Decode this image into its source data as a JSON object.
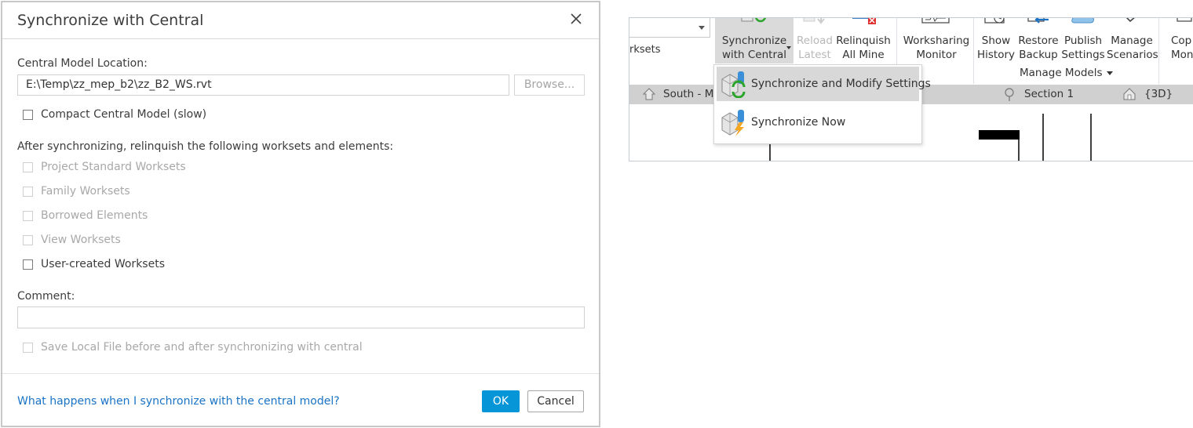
{
  "dialog": {
    "title": "Synchronize with Central",
    "central_model_label": "Central Model Location:",
    "central_model_value": "E:\\Temp\\zz_mep_b2\\zz_B2_WS.rvt",
    "browse_label": "Browse...",
    "compact_label": "Compact Central Model (slow)",
    "relinquish_heading": "After synchronizing, relinquish the following worksets and elements:",
    "relinquish_options": [
      {
        "label": "Project Standard Worksets",
        "enabled": false
      },
      {
        "label": "Family Worksets",
        "enabled": false
      },
      {
        "label": "Borrowed Elements",
        "enabled": false
      },
      {
        "label": "View Worksets",
        "enabled": false
      },
      {
        "label": "User-created Worksets",
        "enabled": true
      }
    ],
    "comment_label": "Comment:",
    "comment_value": "",
    "save_local_label": "Save Local File before and after synchronizing with central",
    "help_link": "What happens when I synchronize with the central model?",
    "ok_label": "OK",
    "cancel_label": "Cancel"
  },
  "ribbon": {
    "worksets_label": "rksets",
    "buttons": [
      {
        "l1": "Synchronize",
        "l2": "with Central"
      },
      {
        "l1": "Reload",
        "l2": "Latest"
      },
      {
        "l1": "Relinquish",
        "l2": "All Mine"
      },
      {
        "l1": "Worksharing",
        "l2": "Monitor"
      },
      {
        "l1": "Show",
        "l2": "History"
      },
      {
        "l1": "Restore",
        "l2": "Backup"
      },
      {
        "l1": "Publish",
        "l2": "Settings"
      },
      {
        "l1": "Manage",
        "l2": "Scenarios"
      },
      {
        "l1": "Cop",
        "l2": "Mon"
      }
    ],
    "panel_title": "Manage Models",
    "view_tabs": {
      "south": "South - M",
      "section": "Section 1",
      "three_d": "{3D}"
    }
  },
  "dropdown": {
    "items": [
      {
        "label": "Synchronize and Modify Settings"
      },
      {
        "label": "Synchronize Now"
      }
    ]
  },
  "colors": {
    "accent": "#0696d7",
    "link": "#1a73c5"
  }
}
